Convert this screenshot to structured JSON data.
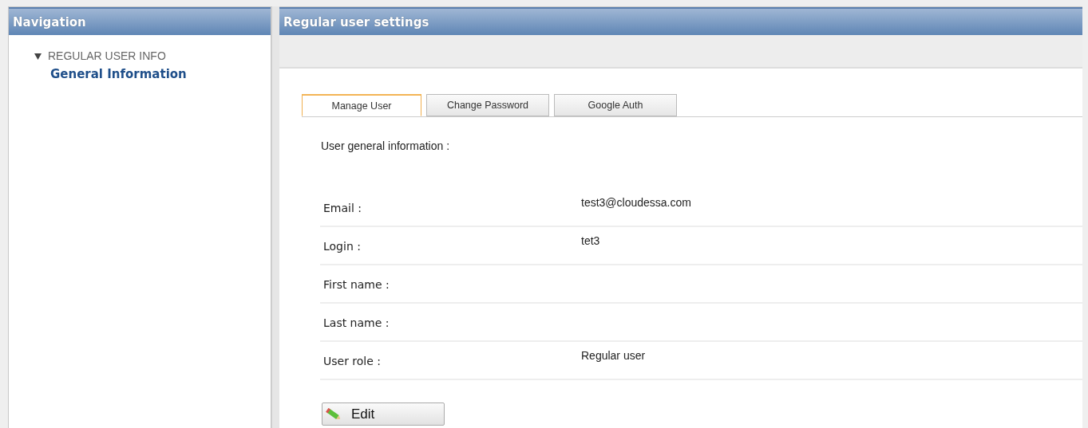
{
  "navigation": {
    "title": "Navigation",
    "groups": [
      {
        "label": "REGULAR USER INFO",
        "expanded": true,
        "children": [
          {
            "label": "General Information",
            "selected": true
          }
        ]
      }
    ]
  },
  "main": {
    "title": "Regular user settings",
    "tabs": [
      {
        "label": "Manage User",
        "selected": true
      },
      {
        "label": "Change Password",
        "selected": false
      },
      {
        "label": "Google Auth",
        "selected": false
      }
    ],
    "section_title": "User general information :",
    "fields": [
      {
        "label": "Email :",
        "value": "test3@cloudessa.com"
      },
      {
        "label": "Login :",
        "value": "tet3"
      },
      {
        "label": "First name :"
      },
      {
        "label": "Last name :"
      },
      {
        "label": "User role :",
        "value": "Regular user"
      }
    ],
    "edit_button": "Edit"
  }
}
